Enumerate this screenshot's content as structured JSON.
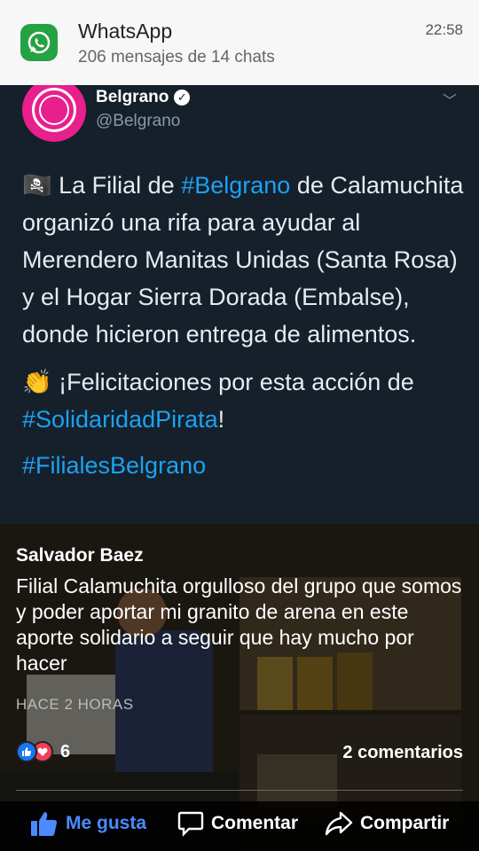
{
  "notification": {
    "app_name": "WhatsApp",
    "subtitle": "206 mensajes de 14 chats",
    "time": "22:58"
  },
  "tweet": {
    "name": "Belgrano",
    "handle": "@Belgrano",
    "para1_before": " La Filial de ",
    "para1_tag": "#Belgrano",
    "para1_after": " de Calamuchita organizó una rifa para ayudar al Merendero Manitas Unidas (Santa Rosa) y el Hogar Sierra Dorada (Embalse), donde hicieron entrega de alimentos.",
    "para2_before": "👏 ¡Felicitaciones por esta acción de ",
    "para2_tag": "#SolidaridadPirata",
    "para2_after": "!",
    "para3_tag": "#FilialesBelgrano",
    "flag_emoji": "🏴‍☠️"
  },
  "post": {
    "author": "Salvador Baez",
    "caption": "Filial Calamuchita orgulloso del grupo que somos y poder aportar mi granito de arena en este aporte solidario a seguir que hay mucho por hacer",
    "time": "HACE 2 HORAS",
    "reaction_count": "6",
    "comments": "2 comentarios"
  },
  "actions": {
    "like": "Me gusta",
    "comment": "Comentar",
    "share": "Compartir"
  },
  "colors": {
    "whatsapp_green": "#25a244",
    "twitter_bg": "#15202b",
    "hashtag_blue": "#1da1f2",
    "belgrano_pink": "#e81f8d",
    "fb_like_blue": "#4b8bff",
    "fb_love_red": "#f33e58"
  },
  "icons": [
    "whatsapp-icon",
    "verified-icon",
    "chevron-down-icon",
    "like-reaction-icon",
    "love-reaction-icon",
    "thumbs-up-icon",
    "comment-icon",
    "share-icon"
  ]
}
